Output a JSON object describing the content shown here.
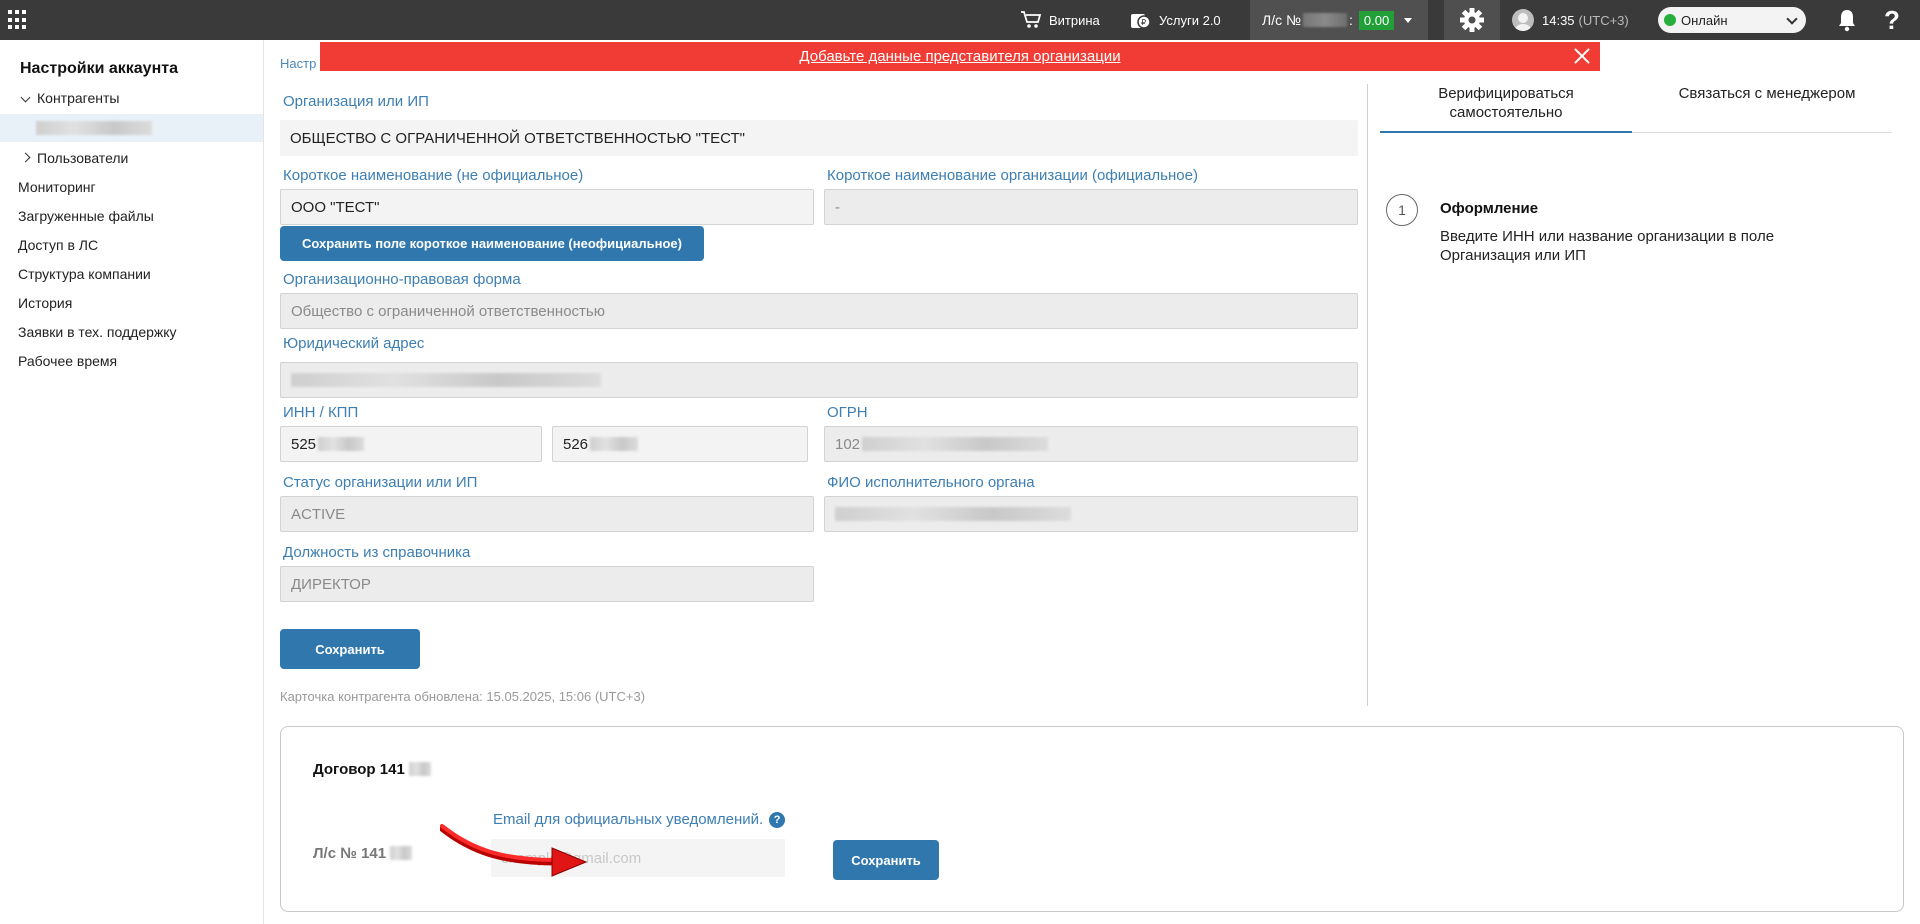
{
  "topbar": {
    "showcase_label": "Витрина",
    "services_label": "Услуги 2.0",
    "account_prefix": "Л/с №",
    "account_suffix": ":",
    "balance": "0.00",
    "time": "14:35",
    "timezone": "(UTC+3)",
    "status": "Онлайн",
    "help_label": "?"
  },
  "banner": {
    "text": "Добавьте данные представителя организации"
  },
  "breadcrumb": {
    "start": "Настр"
  },
  "sidebar": {
    "title": "Настройки аккаунта",
    "counterparties": "Контрагенты",
    "users": "Пользователи",
    "items": [
      "Мониторинг",
      "Загруженные файлы",
      "Доступ в ЛС",
      "Структура компании",
      "История",
      "Заявки в тех. поддержку",
      "Рабочее время"
    ]
  },
  "form": {
    "org_label": "Организация или ИП",
    "org_value": "ОБЩЕСТВО С ОГРАНИЧЕННОЙ ОТВЕТСТВЕННОСТЬЮ \"ТЕСТ\"",
    "short_name_label": "Короткое наименование (не официальное)",
    "short_name_value": "ООО \"ТЕСТ\"",
    "save_short_name_button": "Сохранить поле короткое наименование (неофициальное)",
    "short_official_label": "Короткое наименование организации (официальное)",
    "short_official_value": "-",
    "legal_form_label": "Организационно-правовая форма",
    "legal_form_value": "Общество с ограниченной ответственностью",
    "address_label": "Юридический адрес",
    "inn_kpp_label": "ИНН / КПП",
    "inn_value": "525",
    "kpp_value": "526",
    "ogrn_label": "ОГРН",
    "ogrn_value": "102",
    "status_label": "Статус организации или ИП",
    "status_value": "ACTIVE",
    "executive_label": "ФИО исполнительного органа",
    "position_label": "Должность из справочника",
    "position_value": "ДИРЕКТОР",
    "save_button": "Сохранить",
    "updated_text": "Карточка контрагента обновлена: 15.05.2025, 15:06 (UTC+3)"
  },
  "right_panel": {
    "tabs": [
      "Верифицироваться самостоятельно",
      "Связаться с менеджером"
    ],
    "step_number": "1",
    "step_title": "Оформление",
    "step_text": "Введите ИНН или название организации в поле Организация или ИП"
  },
  "contract": {
    "title": "Договор 141",
    "account_label": "Л/с № 141",
    "email_label": "Email для официальных уведомлений.",
    "email_placeholder": "example@gmail.com",
    "save_button": "Сохранить"
  },
  "colors": {
    "accent": "#2f77ad",
    "banner": "#f03c34",
    "balance": "#21a038",
    "status_online": "#27ae3d"
  }
}
